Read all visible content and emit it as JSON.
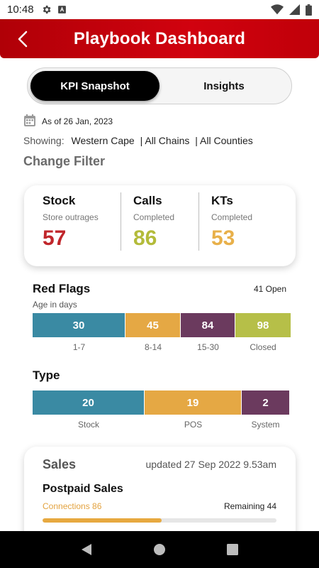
{
  "status_bar": {
    "time": "10:48",
    "icons": [
      "gear-icon",
      "android-icon",
      "wifi-icon",
      "signal-icon",
      "battery-icon"
    ]
  },
  "header": {
    "title": "Playbook Dashboard",
    "back_icon": "chevron-left-icon",
    "bg_color": "#c8020c"
  },
  "tabs": [
    {
      "label": "KPI Snapshot",
      "active": true
    },
    {
      "label": "Insights",
      "active": false
    }
  ],
  "as_of": {
    "icon": "calendar-icon",
    "text": "As of 26 Jan, 2023"
  },
  "filter": {
    "label": "Showing:",
    "region": "Western Cape",
    "chains": "| All Chains",
    "counties": "| All Counties",
    "change_label": "Change Filter"
  },
  "kpis": [
    {
      "title": "Stock",
      "subtitle": "Store outrages",
      "value": "57",
      "color": "#c0262b"
    },
    {
      "title": "Calls",
      "subtitle": "Completed",
      "value": "86",
      "color": "#b3bb3a"
    },
    {
      "title": "KTs",
      "subtitle": "Completed",
      "value": "53",
      "color": "#e8b04a"
    }
  ],
  "red_flags": {
    "title": "Red Flags",
    "open_text": "41 Open",
    "subtitle": "Age in days",
    "segments": [
      {
        "value": "30",
        "label": "1-7",
        "color": "#3a8aa3"
      },
      {
        "value": "45",
        "label": "8-14",
        "color": "#e5a844"
      },
      {
        "value": "84",
        "label": "15-30",
        "color": "#6b3a5e"
      },
      {
        "value": "98",
        "label": "Closed",
        "color": "#b6bf48"
      }
    ]
  },
  "type": {
    "title": "Type",
    "segments": [
      {
        "value": "20",
        "label": "Stock",
        "color": "#3a8aa3"
      },
      {
        "value": "19",
        "label": "POS",
        "color": "#e5a844"
      },
      {
        "value": "2",
        "label": "System",
        "color": "#6b3a5e"
      }
    ]
  },
  "sales": {
    "title": "Sales",
    "updated": "updated 27 Sep 2022 9.53am",
    "postpaid_title": "Postpaid Sales",
    "connections": "Connections 86",
    "remaining": "Remaining 44",
    "progress_fraction": 0.51
  },
  "nav": [
    "back-triangle-icon",
    "home-circle-icon",
    "recents-square-icon"
  ]
}
